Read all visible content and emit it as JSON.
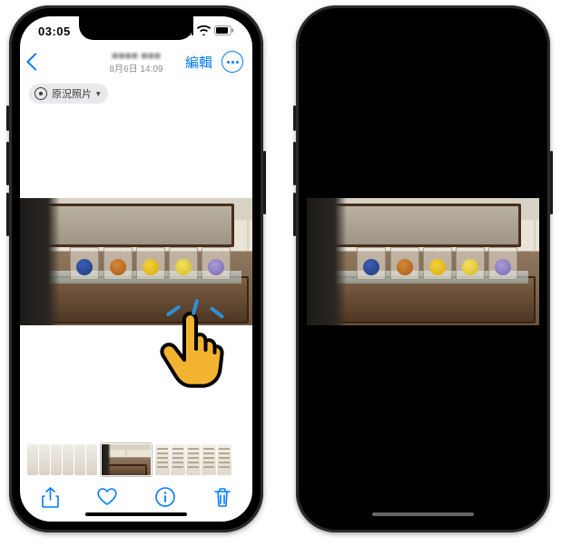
{
  "status": {
    "time": "03:05"
  },
  "nav": {
    "title_blur": "■■■■ ■■■",
    "subtitle": "8月6日 14:09",
    "edit_label": "編輯"
  },
  "live_badge": {
    "label": "原況照片"
  },
  "icons": {
    "back": "chevron-left",
    "more": "ellipsis-circle",
    "share": "square-and-arrow-up",
    "favorite": "heart",
    "info": "info-circle",
    "trash": "trash",
    "live": "livephoto",
    "dropdown": "chevron-down",
    "signal": "cellular",
    "wifi": "wifi",
    "battery": "battery"
  },
  "gesture": {
    "hint": "tap"
  },
  "colors": {
    "tint": "#007aff"
  }
}
